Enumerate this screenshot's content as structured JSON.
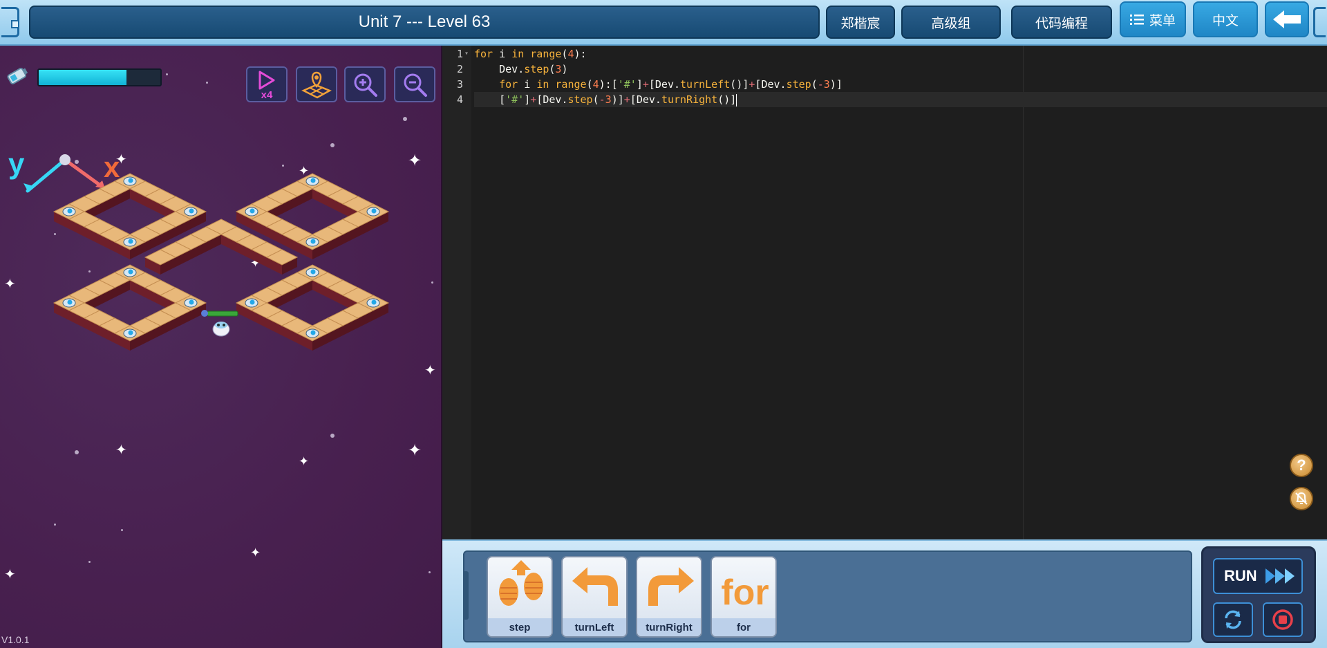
{
  "header": {
    "title": "Unit 7 --- Level 63",
    "user_name": "郑楷宸",
    "group": "高级组",
    "mode": "代码编程",
    "menu_label": "菜单",
    "language_label": "中文"
  },
  "game": {
    "energy_level": 0.72,
    "speed_label": "x4",
    "axis_y": "y",
    "axis_x": "x",
    "version": "V1.0.1",
    "tools": [
      "play-speed-icon",
      "map-pin-icon",
      "zoom-in-icon",
      "zoom-out-icon"
    ]
  },
  "editor": {
    "line_numbers": [
      "1",
      "2",
      "3",
      "4"
    ],
    "lines": [
      "for i in range(4):",
      "    Dev.step(3)",
      "    for i in range(4):['#']+[Dev.turnLeft()]+[Dev.step(-3)]",
      "    ['#']+[Dev.step(-3)]+[Dev.turnRight()]"
    ]
  },
  "blocks": [
    {
      "label": "step",
      "icon": "footsteps-icon"
    },
    {
      "label": "turnLeft",
      "icon": "turn-left-arrow-icon"
    },
    {
      "label": "turnRight",
      "icon": "turn-right-arrow-icon"
    },
    {
      "label": "for",
      "icon": "for-loop-icon"
    }
  ],
  "controls": {
    "run_label": "RUN",
    "help_icon": "help-icon",
    "mute_icon": "bell-off-icon",
    "reset_icon": "refresh-icon",
    "stop_icon": "stop-icon"
  },
  "colors": {
    "accent": "#1f86c6",
    "game_bg": "#48204f",
    "editor_bg": "#1e1e1e",
    "tile": "#e8b87a",
    "progress": "#37e2f5"
  }
}
